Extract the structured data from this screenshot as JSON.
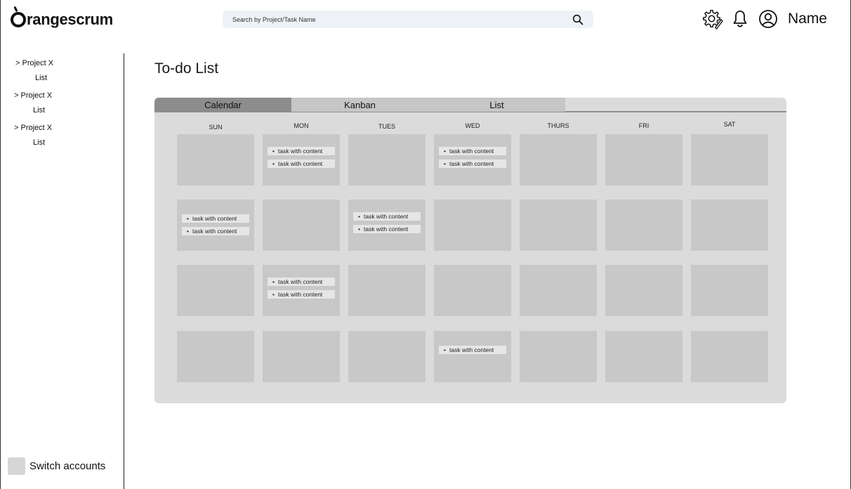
{
  "header": {
    "brand": "rangescrum",
    "search_placeholder": "Search by Project/Task Name",
    "user_name": "Name"
  },
  "sidebar": {
    "projects": [
      {
        "label": "> Project X",
        "sub": "List"
      },
      {
        "label": "> Project X",
        "sub": "List"
      },
      {
        "label": "> Project X",
        "sub": "List"
      }
    ],
    "switch_accounts": "Switch accounts"
  },
  "main": {
    "title": "To-do List",
    "tabs": [
      {
        "label": "Calendar",
        "active": true
      },
      {
        "label": "Kanban",
        "active": false
      },
      {
        "label": "List",
        "active": false
      }
    ],
    "days": [
      "SUN",
      "MON",
      "TUES",
      "WED",
      "THURS",
      "FRI",
      "SAT"
    ],
    "task_label": "task with content",
    "weeks": [
      [
        0,
        2,
        0,
        2,
        0,
        0,
        0
      ],
      [
        2,
        0,
        2,
        0,
        0,
        0,
        0
      ],
      [
        0,
        2,
        0,
        0,
        0,
        0,
        0
      ],
      [
        0,
        0,
        0,
        1,
        0,
        0,
        0
      ]
    ]
  },
  "colors": {
    "active_tab": "#8c8c8c",
    "inactive_tab": "#c6c6c6",
    "panel": "#dbdbdb",
    "cell": "#c8c8c8",
    "task": "#e6e6e6",
    "search_bg": "#eef2f6"
  }
}
